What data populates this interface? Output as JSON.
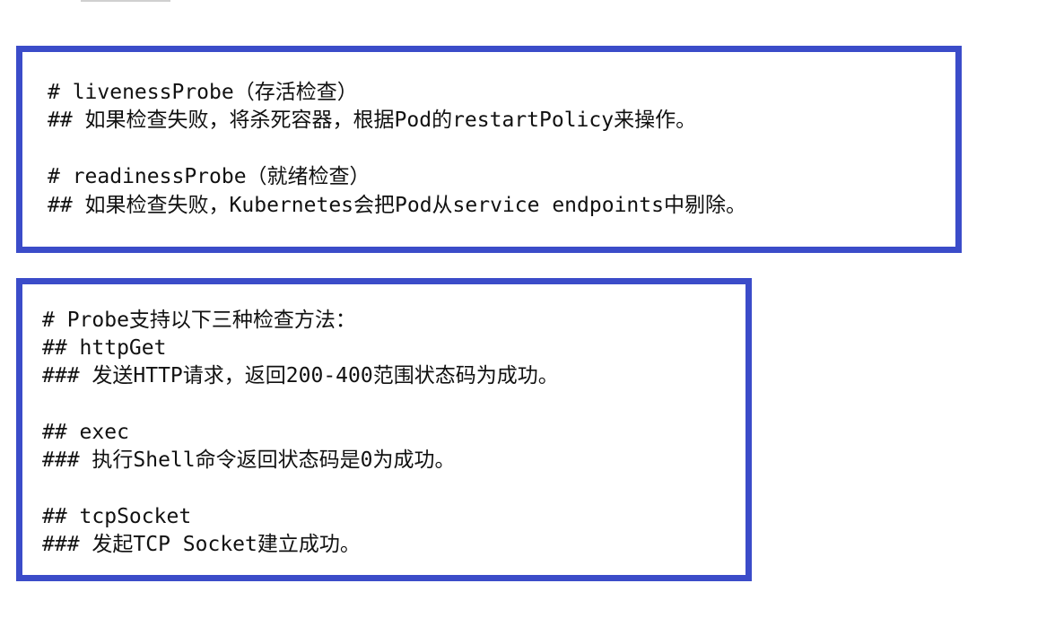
{
  "box1": {
    "lines": [
      "# livenessProbe（存活检查）",
      "## 如果检查失败，将杀死容器，根据Pod的restartPolicy来操作。",
      "# readinessProbe（就绪检查）",
      "## 如果检查失败，Kubernetes会把Pod从service endpoints中剔除。"
    ]
  },
  "box2": {
    "lines": [
      "# Probe支持以下三种检查方法：",
      "## httpGet",
      "### 发送HTTP请求，返回200-400范围状态码为成功。",
      "## exec",
      "### 执行Shell命令返回状态码是0为成功。",
      "## tcpSocket",
      "### 发起TCP Socket建立成功。"
    ]
  },
  "colors": {
    "border": "#3b4cc9",
    "text": "#111111",
    "background": "#ffffff"
  }
}
